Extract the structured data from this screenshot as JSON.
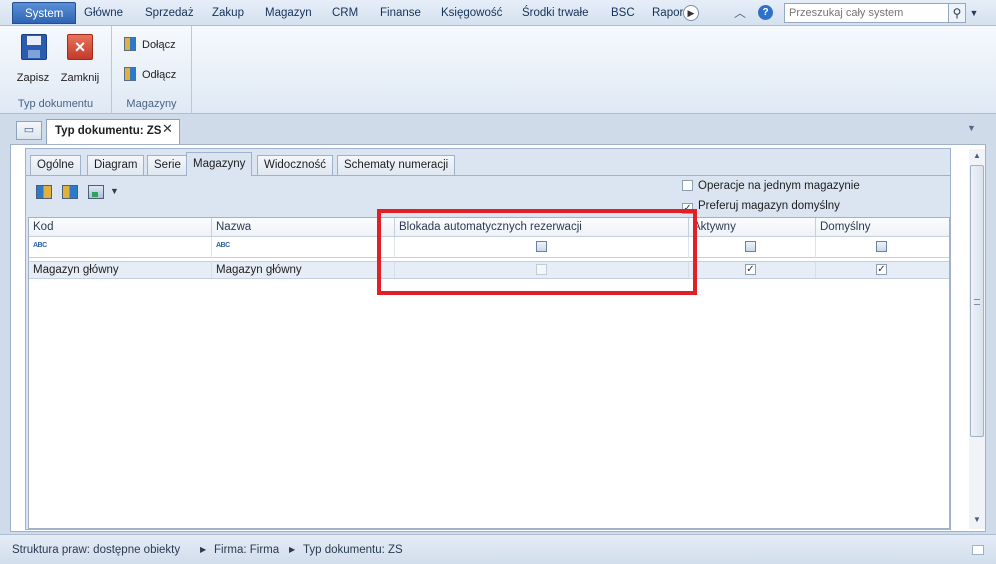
{
  "menu": {
    "items": [
      "System",
      "Główne",
      "Sprzedaż",
      "Zakup",
      "Magazyn",
      "CRM",
      "Finanse",
      "Księgowość",
      "Środki trwałe",
      "BSC",
      "Rapor"
    ],
    "active": "System"
  },
  "search": {
    "placeholder": "Przeszukaj cały system"
  },
  "ribbon": {
    "save_label": "Zapisz",
    "close_label": "Zamknij",
    "group1_label": "Typ dokumentu",
    "attach_label": "Dołącz",
    "detach_label": "Odłącz",
    "group2_label": "Magazyny"
  },
  "doc_tab": {
    "title": "Typ dokumentu: ZS"
  },
  "tabs": [
    "Ogólne",
    "Diagram",
    "Serie",
    "Magazyny",
    "Widoczność",
    "Schematy numeracji"
  ],
  "active_tab": "Magazyny",
  "options": {
    "single_warehouse": {
      "label": "Operacje na jednym magazynie",
      "checked": false
    },
    "prefer_default": {
      "label": "Preferuj magazyn domyślny",
      "checked": true
    }
  },
  "grid": {
    "columns": [
      "Kod",
      "Nazwa",
      "Blokada automatycznych rezerwacji",
      "Aktywny",
      "Domyślny"
    ],
    "filter_abc": "ABC",
    "rows": [
      {
        "kod": "Magazyn główny",
        "nazwa": "Magazyn główny",
        "blokada": false,
        "aktywny": true,
        "domyslny": true
      }
    ]
  },
  "status": {
    "crumbs": [
      "Struktura praw: dostępne obiekty",
      "Firma: Firma",
      "Typ dokumentu: ZS"
    ]
  },
  "colors": {
    "highlight": "#e01f26",
    "accent": "#2f64b4"
  }
}
